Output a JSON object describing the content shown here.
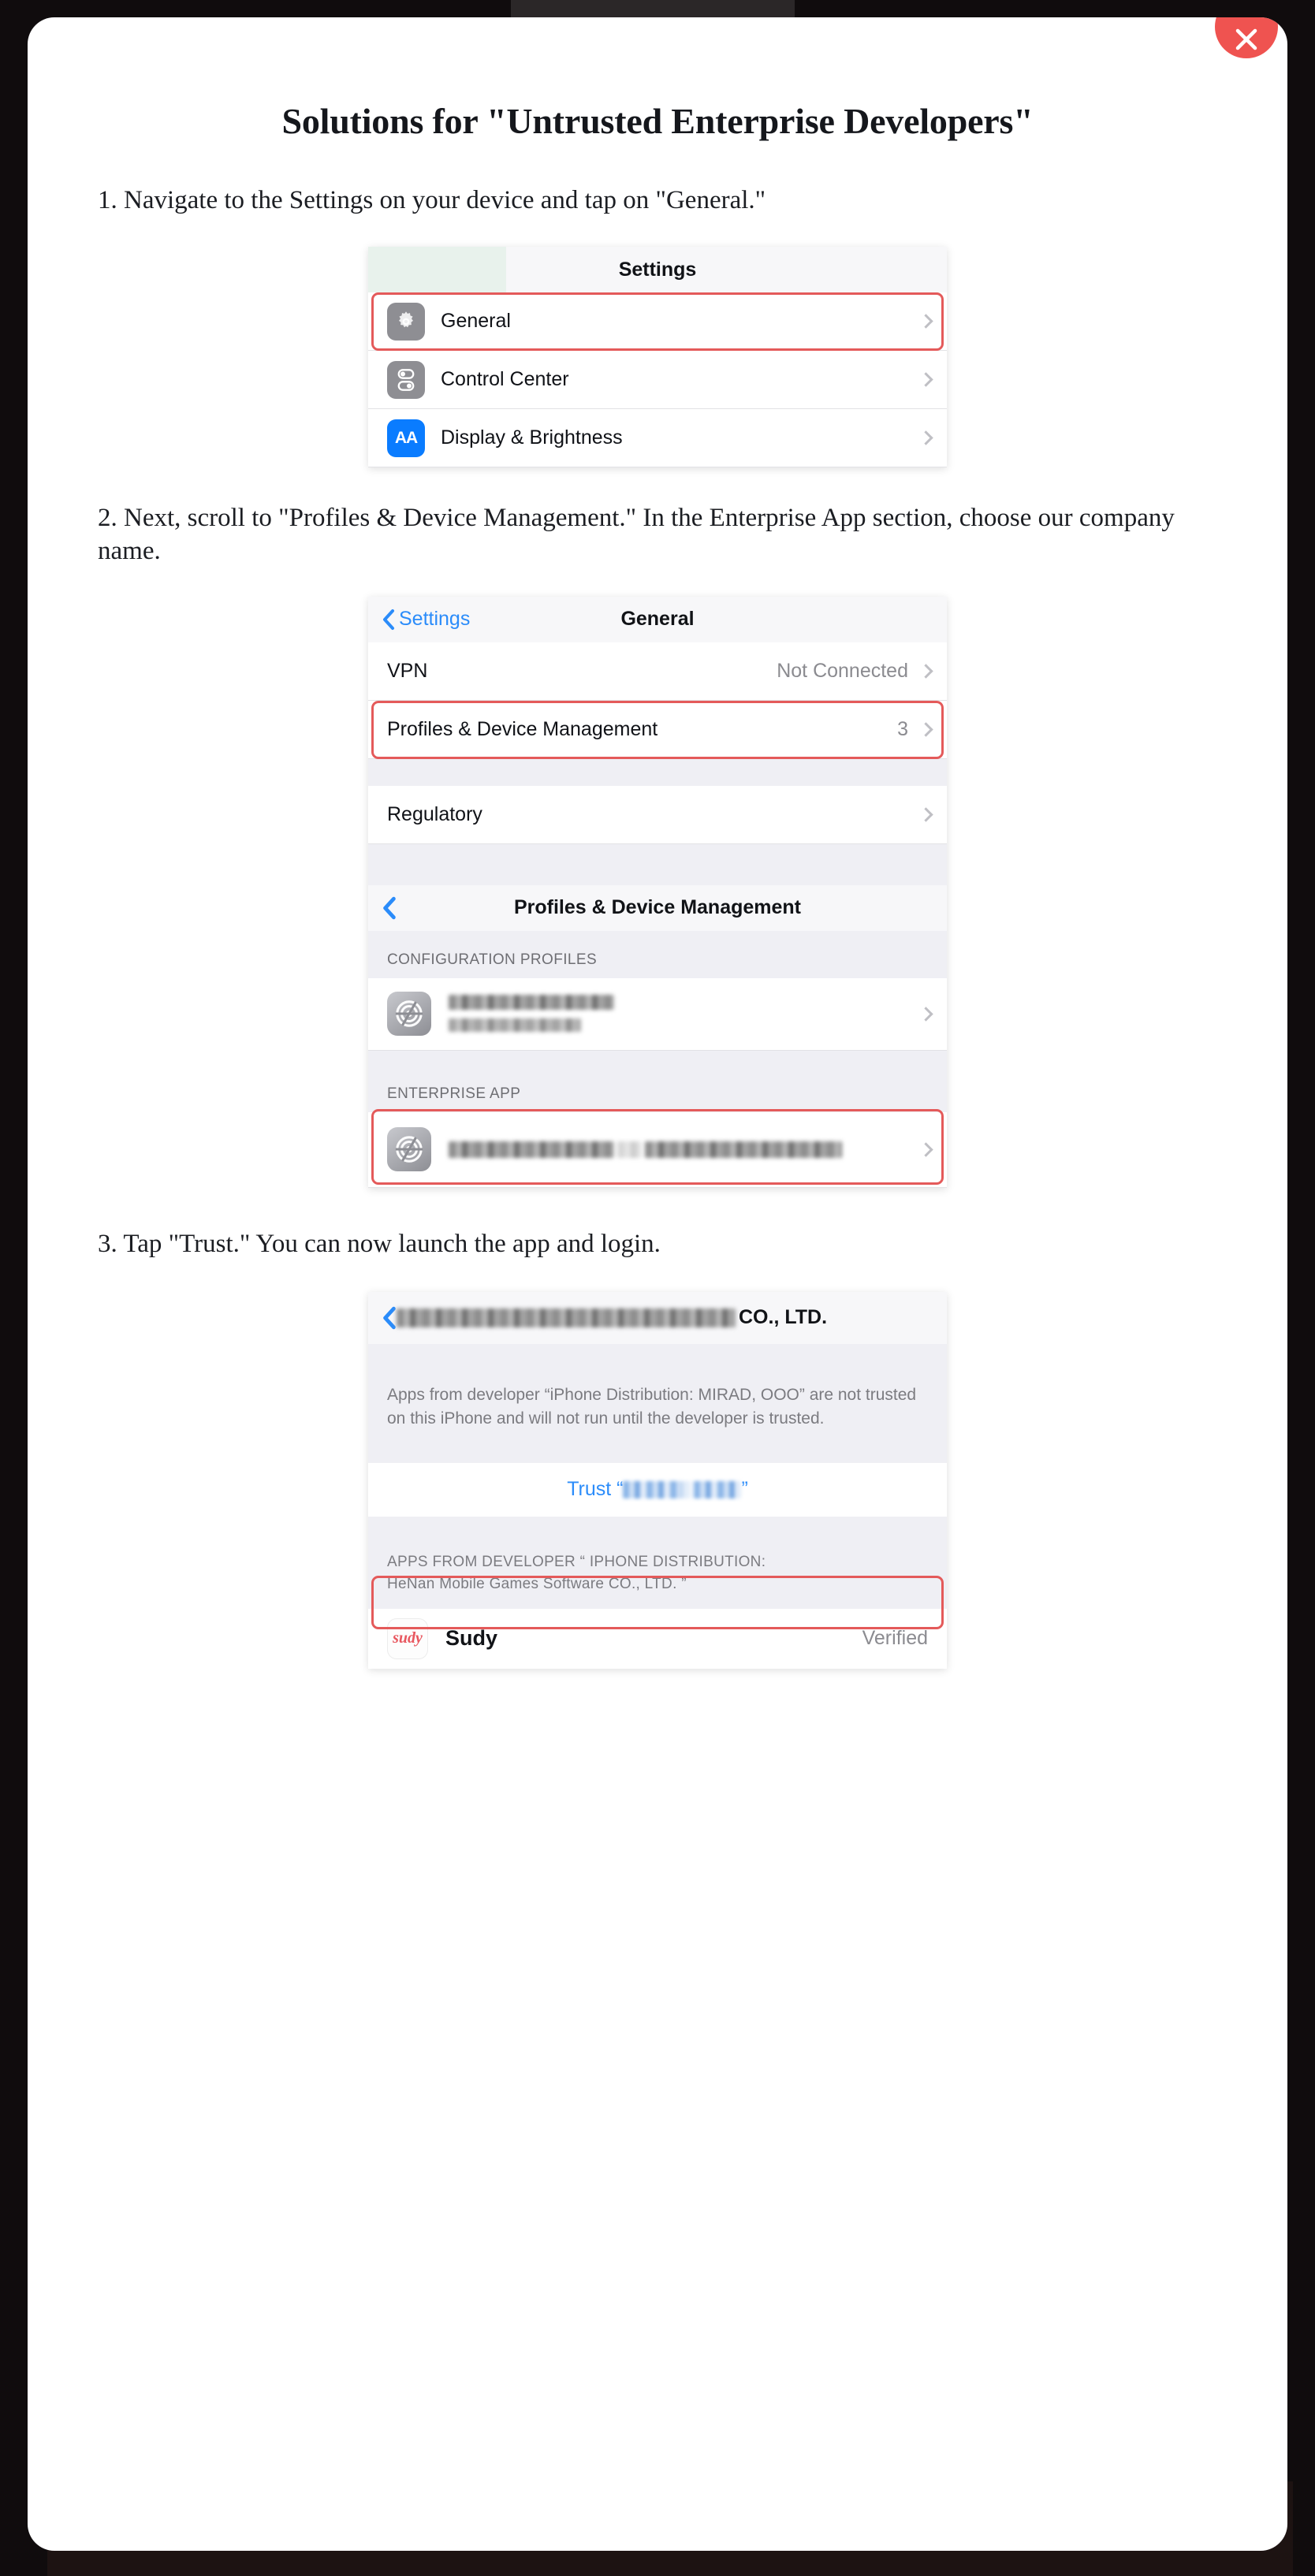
{
  "modal": {
    "close_label": "×",
    "close_icon": "close-icon"
  },
  "page": {
    "title": "Solutions for \"Untrusted Enterprise Developers\""
  },
  "steps": [
    {
      "number": "1.",
      "text": "1. Navigate to the Settings on your device and tap on \"General.\""
    },
    {
      "number": "2.",
      "text": "2. Next, scroll to \"Profiles & Device Management.\" In the Enterprise App section, choose our company name."
    },
    {
      "number": "3.",
      "text": "3. Tap \"Trust.\" You can now launch the app and login."
    }
  ],
  "screenshot_settings": {
    "nav_title": "Settings",
    "rows": [
      {
        "label": "General",
        "icon": "gear-icon",
        "highlighted": true
      },
      {
        "label": "Control Center",
        "icon": "control-center-icon",
        "highlighted": false
      },
      {
        "label": "Display & Brightness",
        "icon": "display-brightness-icon",
        "icon_text": "AA",
        "highlighted": false
      }
    ]
  },
  "screenshot_general": {
    "back_label": "Settings",
    "nav_title": "General",
    "rows": [
      {
        "label": "VPN",
        "value": "Not Connected",
        "highlighted": false
      },
      {
        "label": "Profiles & Device Management",
        "value": "3",
        "highlighted": true
      },
      {
        "label": "Regulatory",
        "value": "",
        "highlighted": false
      }
    ],
    "profiles_nav_title": "Profiles & Device Management",
    "section_configuration": "CONFIGURATION PROFILES",
    "section_enterprise": "ENTERPRISE APP",
    "configuration_profile_name": "[redacted]",
    "configuration_profile_subtitle": "[redacted]",
    "enterprise_app_name": "[redacted]"
  },
  "screenshot_trust": {
    "nav_company_redacted": "[redacted]",
    "nav_company_suffix": "CO., LTD.",
    "description": "Apps from developer “iPhone Distribution: MIRAD, OOO” are not trusted on this iPhone and will not run until the developer is trusted.",
    "trust_button_prefix": "Trust “",
    "trust_button_redacted": "[redacted]",
    "trust_button_suffix": "”",
    "footer_line1": "APPS FROM  DEVELOPER “ IPHONE  DISTRIBUTION:",
    "footer_line2": "HeNan Mobile Games Software CO., LTD. ”",
    "app": {
      "logo_text": "sudy",
      "name": "Sudy",
      "status": "Verified"
    }
  },
  "colors": {
    "close_button": "#ef5350",
    "highlight": "#e45a5a",
    "ios_blue": "#2b8cfa",
    "ios_gray_bg": "#efeff4"
  }
}
